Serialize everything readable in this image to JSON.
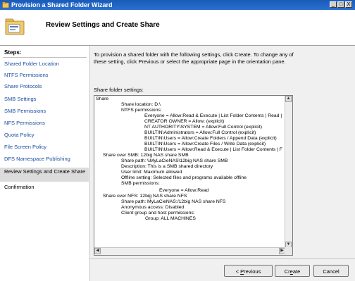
{
  "window": {
    "title": "Provision a Shared Folder Wizard",
    "controls": [
      "_",
      "□",
      "X"
    ]
  },
  "header": {
    "title": "Review Settings and Create Share"
  },
  "sidebar": {
    "heading": "Steps:",
    "items": [
      {
        "label": "Shared Folder Location"
      },
      {
        "label": "NTFS Permissions"
      },
      {
        "label": "Share Protocols"
      },
      {
        "label": "SMB Settings"
      },
      {
        "label": "SMB Permissions"
      },
      {
        "label": "NFS Permissions"
      },
      {
        "label": "Quota Policy"
      },
      {
        "label": "File Screen Policy"
      },
      {
        "label": "DFS Namespace Publishing"
      },
      {
        "label": "Review Settings and Create Share",
        "active": true
      },
      {
        "label": "Confirmation"
      }
    ]
  },
  "main": {
    "intro_line1": "To provision a shared folder with the following settings, click Create. To change any of",
    "intro_line2": "these setting, click Previous or select the appropriate page in the orientation pane.",
    "settings_label": "Share folder settings:",
    "settings_lines": [
      "Share",
      "Share location: D:\\",
      "NTFS permissions:",
      "Everyone = Allow:Read & Execute | List Folder Contents | Read |",
      "CREATOR OWNER = Allow: (explicit)",
      "NT AUTHORITY\\SYSTEM = Allow:Full Control (explicit)",
      "BUILTIN\\Administrators = Allow:Full Control (explicit)",
      "BUILTIN\\Users = Allow:Create Folders / Append Data (explicit)",
      "BUILTIN\\Users = Allow:Create Files / Write Data (explicit)",
      "BUILTIN\\Users = Allow:Read & Execute | List Folder Contents | F",
      "Share over SMB: 12big NAS share SMB",
      "Share path: \\\\MyLaCieNAS\\12big NAS share SMB",
      "Description: This is a SMB shared directory",
      "User limit: Maximum allowed",
      "Offline setting: Selected files and programs available offline",
      "SMB permissions:",
      "Everyone = Allow:Read",
      "Share over NFS: 12big NAS share NFS",
      "Share path: MyLaCieNAS:/12big NAS share NFS",
      "Anonymous access: Disabled",
      "Client group and host permissions:",
      "Group: ALL MACHINES"
    ]
  },
  "footer": {
    "previous_pre": "< ",
    "previous_key": "P",
    "previous_rest": "revious",
    "create_pre": "Cr",
    "create_key": "e",
    "create_rest": "ate",
    "cancel": "Cancel"
  }
}
